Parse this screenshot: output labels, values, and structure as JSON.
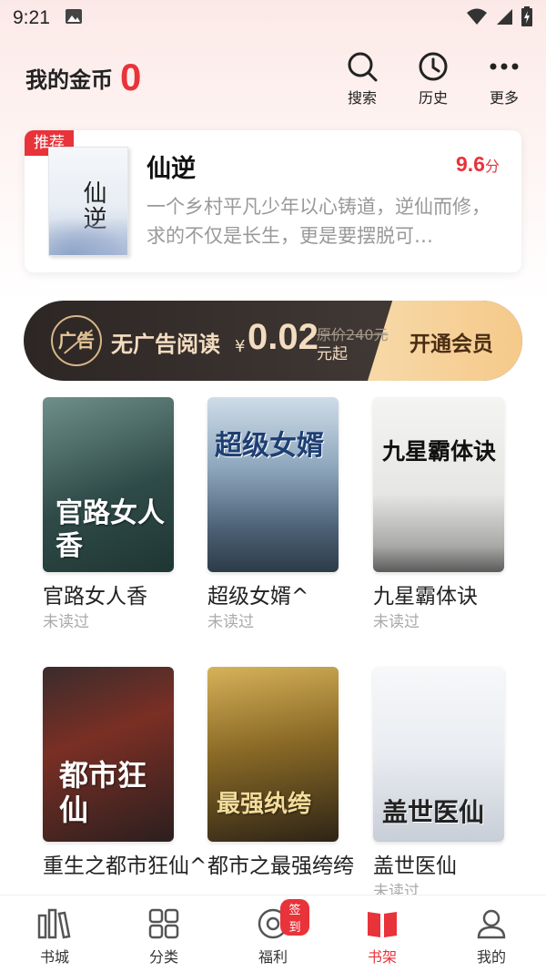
{
  "status_bar": {
    "time": "9:21"
  },
  "header": {
    "coins_label": "我的金币",
    "coins_value": "0",
    "actions": [
      {
        "label": "搜索",
        "icon": "search-icon"
      },
      {
        "label": "历史",
        "icon": "clock-icon"
      },
      {
        "label": "更多",
        "icon": "more-icon"
      }
    ]
  },
  "recommend": {
    "tag": "推荐",
    "title": "仙逆",
    "score": "9.6",
    "score_unit": "分",
    "description": "一个乡村平凡少年以心铸道，逆仙而修，求的不仅是长生，更是要摆脱可…",
    "cover_text": "仙逆"
  },
  "vip_banner": {
    "icon_text": "广告",
    "label": "无广告阅读",
    "currency": "¥",
    "price": "0.02",
    "original_price": "原价240元",
    "suffix": "元起",
    "button": "开通会员",
    "colors": {
      "dark": "#2c2624",
      "gold": "#f5c98a"
    }
  },
  "books": [
    {
      "title": "官路女人香",
      "status": "未读过",
      "cover_text": "官路女人香"
    },
    {
      "title": "超级女婿^",
      "status": "未读过",
      "cover_text": "超级女婿"
    },
    {
      "title": "九星霸体诀",
      "status": "未读过",
      "cover_text": "九星霸体诀"
    },
    {
      "title": "重生之都市狂仙^",
      "status": "",
      "cover_text": "都市狂仙"
    },
    {
      "title": "都市之最强绔绔",
      "status": "",
      "cover_text": "最强纨绔"
    },
    {
      "title": "盖世医仙",
      "status": "未读过",
      "cover_text": "盖世医仙"
    }
  ],
  "tabbar": {
    "tabs": [
      {
        "label": "书城",
        "icon": "bookstore-icon"
      },
      {
        "label": "分类",
        "icon": "category-icon"
      },
      {
        "label": "福利",
        "icon": "welfare-icon",
        "badge": "签到"
      },
      {
        "label": "书架",
        "icon": "bookshelf-icon",
        "active": true
      },
      {
        "label": "我的",
        "icon": "profile-icon"
      }
    ]
  },
  "accent_color": "#e8333a"
}
